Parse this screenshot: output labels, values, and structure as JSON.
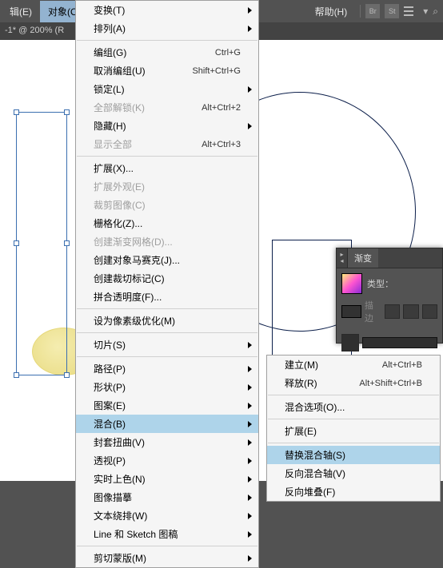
{
  "menubar": {
    "items": [
      {
        "label": "辑(E)"
      },
      {
        "label": "对象(O)"
      }
    ],
    "help": "帮助(H)",
    "icons": [
      "Br",
      "St"
    ]
  },
  "doc": {
    "title": "-1* @ 200% (R"
  },
  "menu": {
    "items": [
      {
        "label": "变换(T)",
        "arrow": true
      },
      {
        "label": "排列(A)",
        "arrow": true
      },
      {
        "sep": true
      },
      {
        "label": "编组(G)",
        "shortcut": "Ctrl+G"
      },
      {
        "label": "取消编组(U)",
        "shortcut": "Shift+Ctrl+G"
      },
      {
        "label": "锁定(L)",
        "arrow": true
      },
      {
        "label": "全部解锁(K)",
        "shortcut": "Alt+Ctrl+2",
        "disabled": true
      },
      {
        "label": "隐藏(H)",
        "arrow": true
      },
      {
        "label": "显示全部",
        "shortcut": "Alt+Ctrl+3",
        "disabled": true
      },
      {
        "sep": true
      },
      {
        "label": "扩展(X)..."
      },
      {
        "label": "扩展外观(E)",
        "disabled": true
      },
      {
        "label": "裁剪图像(C)",
        "disabled": true
      },
      {
        "label": "栅格化(Z)..."
      },
      {
        "label": "创建渐变网格(D)...",
        "disabled": true
      },
      {
        "label": "创建对象马赛克(J)..."
      },
      {
        "label": "创建裁切标记(C)"
      },
      {
        "label": "拼合透明度(F)..."
      },
      {
        "sep": true
      },
      {
        "label": "设为像素级优化(M)"
      },
      {
        "sep": true
      },
      {
        "label": "切片(S)",
        "arrow": true
      },
      {
        "sep": true
      },
      {
        "label": "路径(P)",
        "arrow": true
      },
      {
        "label": "形状(P)",
        "arrow": true
      },
      {
        "label": "图案(E)",
        "arrow": true
      },
      {
        "label": "混合(B)",
        "arrow": true,
        "highlight": true
      },
      {
        "label": "封套扭曲(V)",
        "arrow": true
      },
      {
        "label": "透视(P)",
        "arrow": true
      },
      {
        "label": "实时上色(N)",
        "arrow": true
      },
      {
        "label": "图像描摹",
        "arrow": true
      },
      {
        "label": "文本绕排(W)",
        "arrow": true
      },
      {
        "label": "Line 和 Sketch 图稿",
        "arrow": true
      },
      {
        "sep": true
      },
      {
        "label": "剪切蒙版(M)",
        "arrow": true
      }
    ]
  },
  "submenu": {
    "items": [
      {
        "label": "建立(M)",
        "shortcut": "Alt+Ctrl+B"
      },
      {
        "label": "释放(R)",
        "shortcut": "Alt+Shift+Ctrl+B"
      },
      {
        "sep": true
      },
      {
        "label": "混合选项(O)..."
      },
      {
        "sep": true
      },
      {
        "label": "扩展(E)"
      },
      {
        "sep": true
      },
      {
        "label": "替换混合轴(S)",
        "highlight": true
      },
      {
        "label": "反向混合轴(V)"
      },
      {
        "label": "反向堆叠(F)"
      }
    ]
  },
  "panel": {
    "title": "渐变",
    "type_label": "类型：",
    "row_label": "描边"
  }
}
